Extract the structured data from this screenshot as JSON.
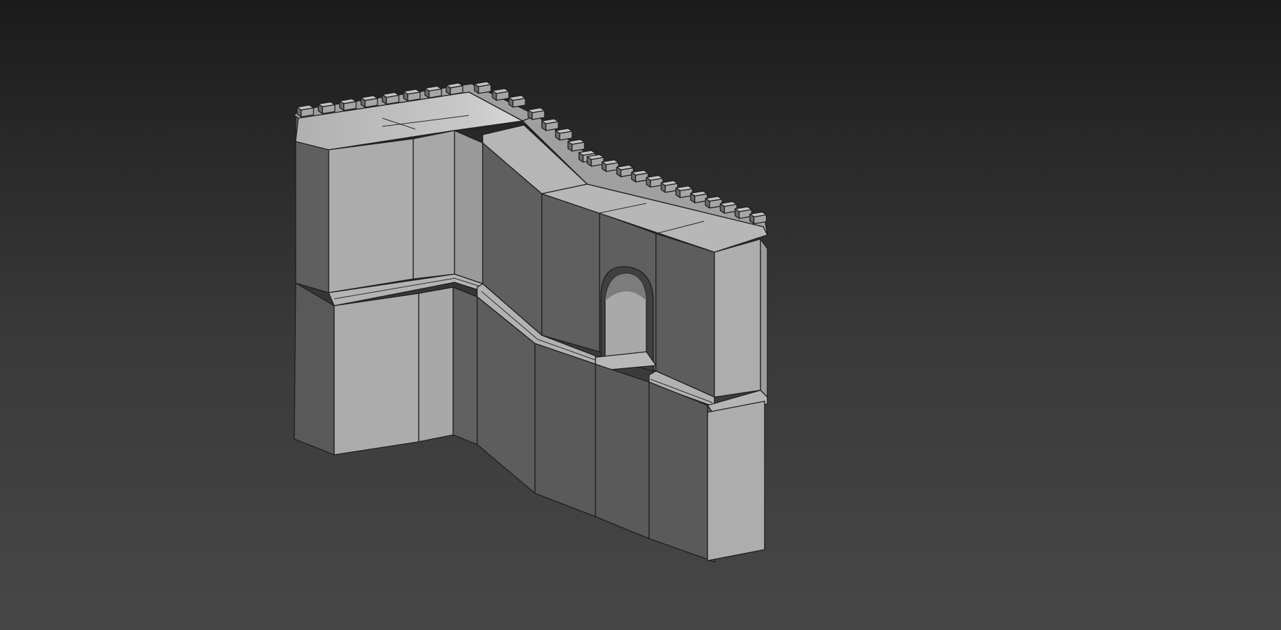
{
  "scene": {
    "object_name": "castle-wall",
    "material": {
      "face_light": "#acacac",
      "face_mid": "#9a9a9a",
      "face_dark": "#5f5f5f",
      "face_darker": "#585858",
      "top": "#b8b8b8",
      "edge": "#1e1e1e"
    },
    "background": {
      "top": "#1b1b1b",
      "bottom": "#474747"
    }
  }
}
